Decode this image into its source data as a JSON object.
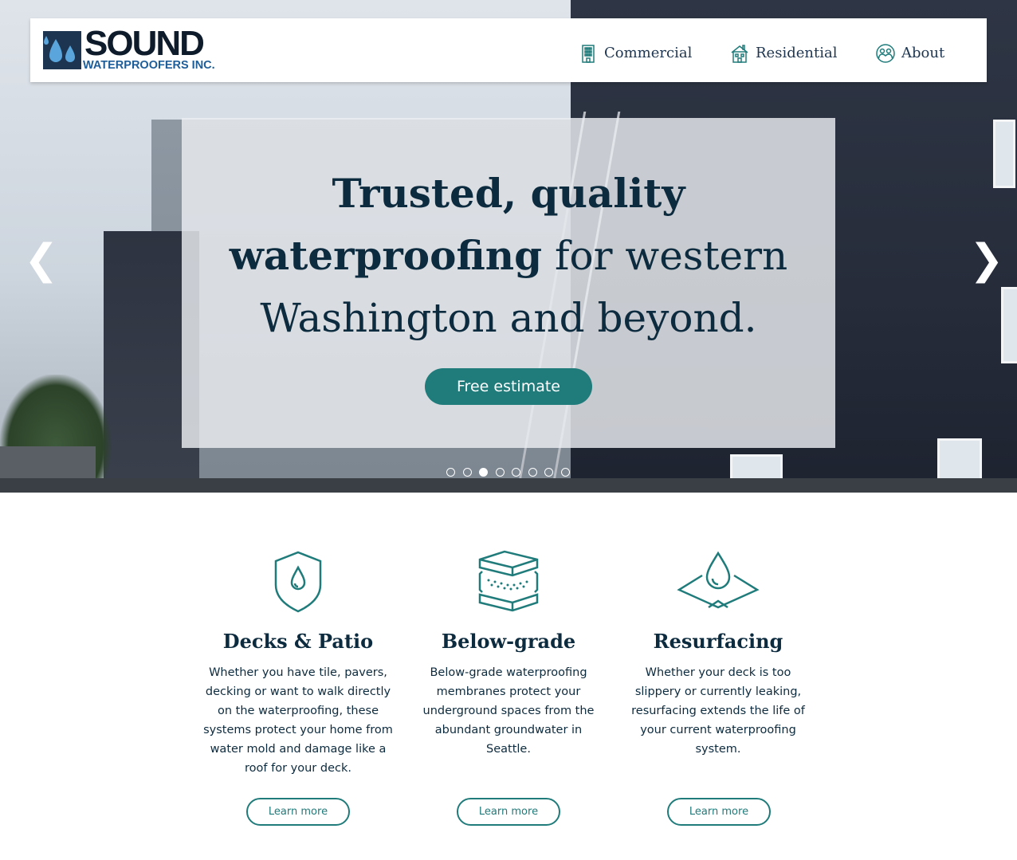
{
  "brand": {
    "logo_word": "SOUND",
    "logo_sub": "WATERPROOFERS INC."
  },
  "nav": {
    "items": [
      {
        "label": "Commercial",
        "icon": "building-icon"
      },
      {
        "label": "Residential",
        "icon": "house-icon"
      },
      {
        "label": "About",
        "icon": "people-icon"
      }
    ]
  },
  "hero": {
    "headline_bold_1": "Trusted, quality",
    "headline_bold_2": "waterproofing",
    "headline_rest_1": " for western",
    "headline_rest_2": "Washington and beyond.",
    "cta_label": "Free estimate",
    "prev_glyph": "❮",
    "next_glyph": "❯",
    "slide_count": 8,
    "active_slide": 3
  },
  "features": [
    {
      "title": "Decks & Patio",
      "icon": "shield-drop-icon",
      "text": "Whether you have tile, pavers, decking or want to walk directly on the waterproofing, these systems protect your home from water mold and damage like a roof for your deck.",
      "button": "Learn more"
    },
    {
      "title": "Below-grade",
      "icon": "layers-icon",
      "text": "Below-grade waterproofing membranes protect your underground spaces from the abundant groundwater in Seattle.",
      "button": "Learn more"
    },
    {
      "title": "Resurfacing",
      "icon": "drop-surface-icon",
      "text": "Whether your deck is too slippery or currently leaking, resurfacing extends the life of your current waterproofing system.",
      "button": "Learn more"
    }
  ],
  "colors": {
    "accent": "#207b7b",
    "navy": "#0d2b3e"
  }
}
